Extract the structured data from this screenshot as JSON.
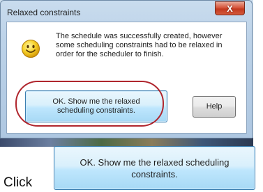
{
  "dialog": {
    "title": "Relaxed constraints",
    "close_label": "X",
    "icon": "smiley-icon",
    "message": "The schedule was successfully created, however some scheduling constraints had to be relaxed in order for the scheduler to finish.",
    "ok_label": "OK. Show me the relaxed scheduling constraints.",
    "help_label": "Help",
    "highlight_color": "#b0262e"
  },
  "instruction": {
    "verb": "Click",
    "button_label": "OK. Show me the relaxed scheduling constraints."
  }
}
